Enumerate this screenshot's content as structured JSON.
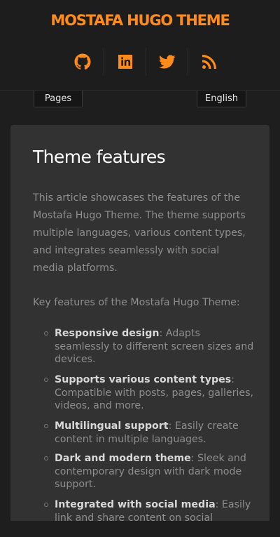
{
  "header": {
    "site_title": "MOSTAFA HUGO THEME",
    "accent_color": "#ff8c1a",
    "social_links": [
      {
        "icon": "github-icon"
      },
      {
        "icon": "linkedin-icon"
      },
      {
        "icon": "twitter-icon"
      },
      {
        "icon": "rss-icon"
      }
    ]
  },
  "menu": {
    "pages_label": "Pages",
    "language_label": "English"
  },
  "article": {
    "title": "Theme features",
    "intro": "This article showcases the features of the Mostafa Hugo Theme. The theme supports multiple languages, various content types, and integrates seamlessly with social media platforms.",
    "key_features_intro": "Key features of the Mostafa Hugo Theme:",
    "features": [
      {
        "name": "Responsive design",
        "desc": ": Adapts seamlessly to different screen sizes and devices."
      },
      {
        "name": "Supports various content types",
        "desc": ": Compatible with posts, pages, galleries, videos, and more."
      },
      {
        "name": "Multilingual support",
        "desc": ": Easily create content in multiple languages."
      },
      {
        "name": "Dark and modern theme",
        "desc": ": Sleek and contemporary design with dark mode support."
      },
      {
        "name": "Integrated with social media",
        "desc": ": Easily link and share content on social"
      }
    ]
  }
}
